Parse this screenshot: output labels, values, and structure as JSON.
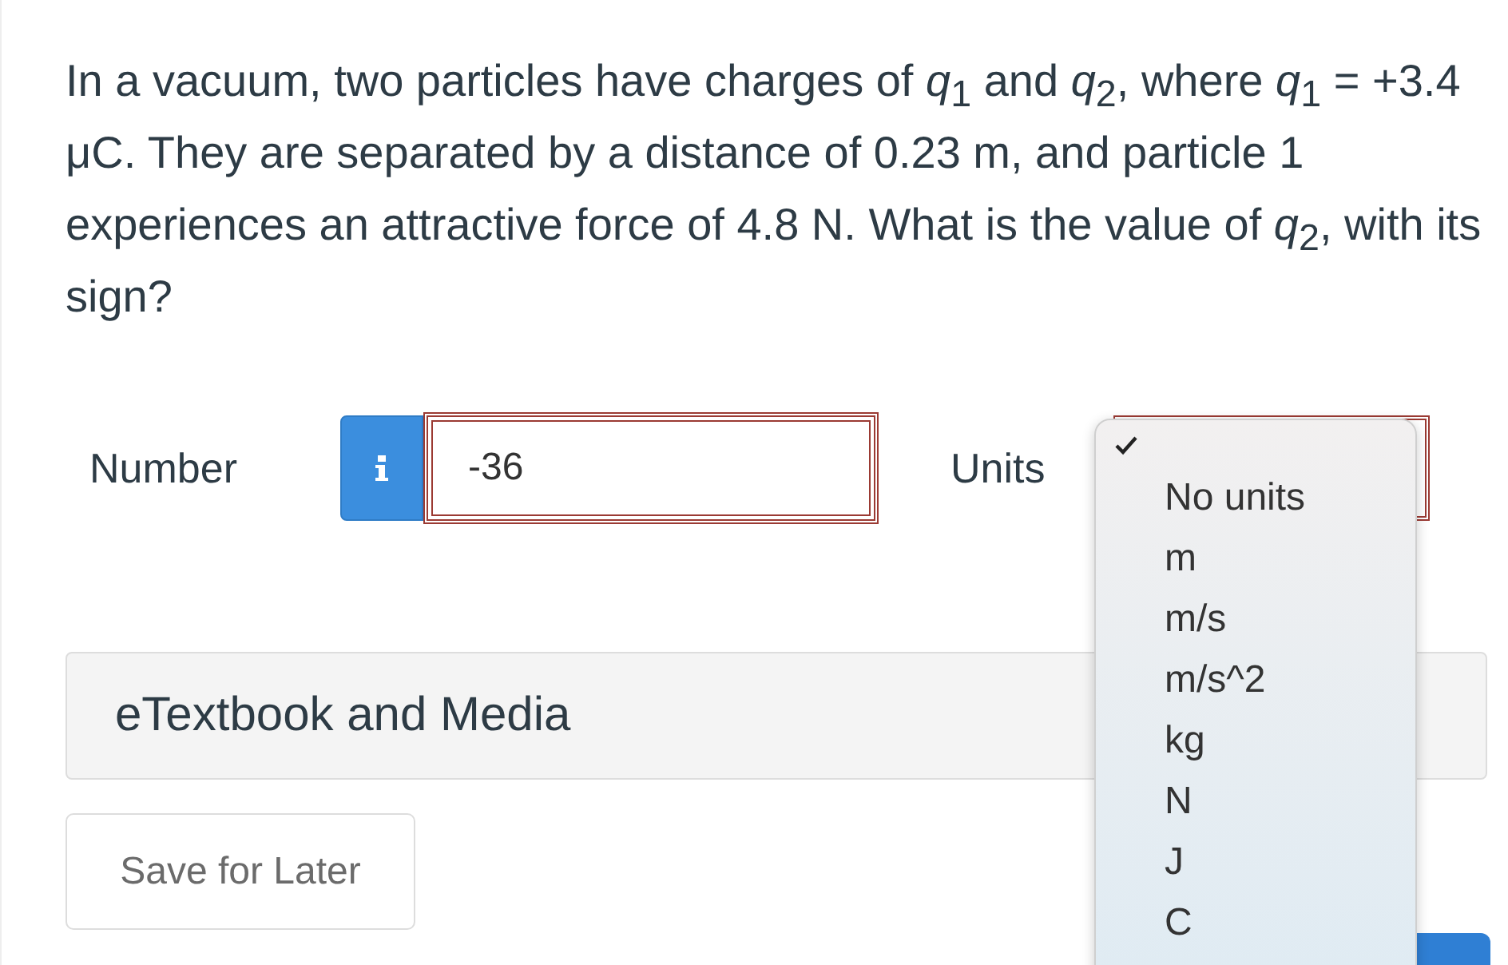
{
  "question": "In a vacuum, two particles have charges of *q*$_{1}$ and *q*$_{2}$, where *q*$_{1}$ = +3.4 μC. They are separated by a distance of 0.23 m, and particle 1 experiences an attractive force of 4.8 N. What is the value of *q*$_{2}$, with its sign?",
  "number": {
    "label": "Number",
    "value": "-36"
  },
  "units": {
    "label": "Units",
    "options": [
      {
        "selected": true
      },
      {
        "label": "No units",
        "selected": false
      },
      {
        "label": "m",
        "selected": false
      },
      {
        "label": "m/s",
        "selected": false
      },
      {
        "label": "m/s^2",
        "selected": false
      },
      {
        "label": "kg",
        "selected": false
      },
      {
        "label": "N",
        "selected": false
      },
      {
        "label": "J",
        "selected": false
      },
      {
        "label": "C",
        "selected": false
      }
    ]
  },
  "media_panel": {
    "title": "eTextbook and Media"
  },
  "buttons": [
    "Save for Later"
  ]
}
